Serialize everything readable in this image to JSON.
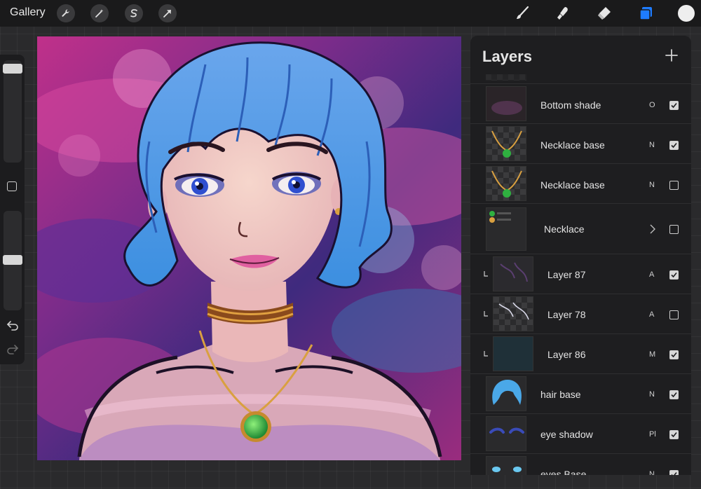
{
  "toolbar": {
    "gallery_label": "Gallery",
    "left_tools": [
      "wrench-icon",
      "magic-wand-icon",
      "selection-icon",
      "transform-arrow-icon"
    ],
    "right_tools": [
      "brush-icon",
      "smudge-icon",
      "eraser-icon",
      "layers-icon"
    ],
    "layers_accent": "#1e7cff",
    "current_color": "#eeeeee"
  },
  "sidebar": {
    "brush_size_level": 0.9,
    "opacity_level": 0.55
  },
  "layers_panel": {
    "title": "Layers",
    "add_icon": "plus-icon",
    "layers": [
      {
        "name": "Bottom shade",
        "blend": "O",
        "visible": true,
        "clipped": false,
        "group": false
      },
      {
        "name": "Necklace base",
        "blend": "N",
        "visible": true,
        "clipped": false,
        "group": false
      },
      {
        "name": "Necklace base",
        "blend": "N",
        "visible": false,
        "clipped": false,
        "group": false
      },
      {
        "name": "Necklace",
        "blend": "",
        "visible": false,
        "clipped": false,
        "group": true
      },
      {
        "name": "Layer 87",
        "blend": "A",
        "visible": true,
        "clipped": true,
        "group": false
      },
      {
        "name": "Layer 78",
        "blend": "A",
        "visible": false,
        "clipped": true,
        "group": false
      },
      {
        "name": "Layer 86",
        "blend": "M",
        "visible": true,
        "clipped": true,
        "group": false
      },
      {
        "name": "hair base",
        "blend": "N",
        "visible": true,
        "clipped": false,
        "group": false
      },
      {
        "name": "eye shadow",
        "blend": "Pl",
        "visible": true,
        "clipped": false,
        "group": false
      },
      {
        "name": "eyes Base",
        "blend": "N",
        "visible": true,
        "clipped": false,
        "group": false
      }
    ]
  }
}
